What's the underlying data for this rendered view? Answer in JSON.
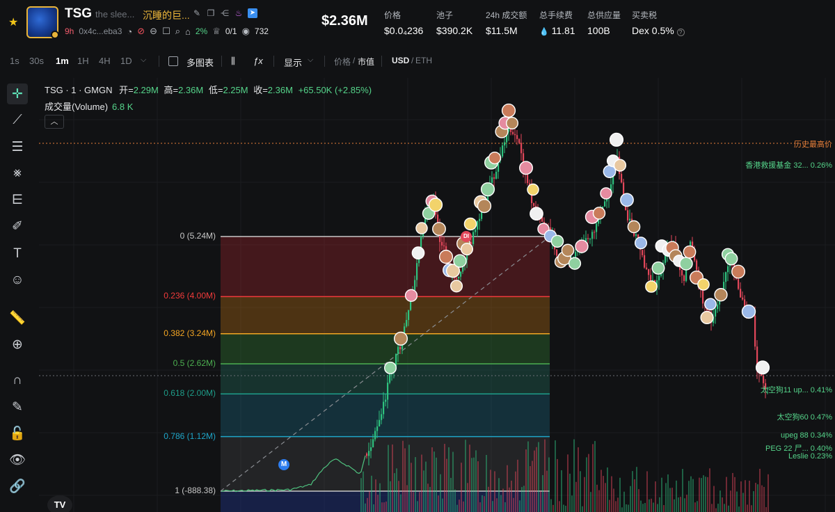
{
  "header": {
    "symbol": "TSG",
    "subtitle": "the slee...",
    "chinese_name": "沉睡的巨...",
    "age": "9h",
    "address": "0x4c...eba3",
    "pct": "2%",
    "holders_ratio": "0/1",
    "views": "732",
    "big_price": "$2.36M",
    "stats": [
      {
        "label": "价格",
        "value": "$0.0₄236"
      },
      {
        "label": "池子",
        "value": "$390.2K"
      },
      {
        "label": "24h 成交额",
        "value": "$11.5M"
      },
      {
        "label": "总手续费",
        "value": "11.81"
      },
      {
        "label": "总供应量",
        "value": "100B"
      },
      {
        "label": "买卖税",
        "value": "Dex 0.5%"
      }
    ],
    "colors": {
      "accent_gold": "#f0b93a",
      "age_red": "#f25c6c",
      "green": "#55d48a"
    },
    "icons": [
      "star-icon",
      "edit-icon",
      "copy-icon",
      "share-icon",
      "flame-icon",
      "telegram-icon",
      "clock-icon",
      "pill-icon",
      "minus-circle-icon",
      "chat-icon",
      "search-icon",
      "cap-icon",
      "crown-icon",
      "eye-icon"
    ]
  },
  "toolbar": {
    "timeframes": [
      "1s",
      "30s",
      "1m",
      "1H",
      "4H",
      "1D"
    ],
    "active_timeframe": "1m",
    "multi_chart": "多图表",
    "display": "显示",
    "price_label": "价格",
    "slash1": "/",
    "mcap_label": "市值",
    "usd": "USD",
    "slash2": "/",
    "eth": "ETH"
  },
  "chart": {
    "legend": {
      "title": "TSG · 1 · GMGN",
      "open_label": "开=",
      "open": "2.29M",
      "high_label": "高=",
      "high": "2.36M",
      "low_label": "低=",
      "low": "2.25M",
      "close_label": "收=",
      "close": "2.36M",
      "change": "+65.50K (+2.85%)"
    },
    "volume_label": "成交量(Volume)",
    "volume_value": "6.8 K",
    "ath_label": "历史最高价",
    "m_badge": "M",
    "d_badge": "DI",
    "right_labels": [
      {
        "text": "香港救援基金 32... 0.26%"
      },
      {
        "text": "太空狗11 up... 0.41%"
      },
      {
        "text": "太空狗60 0.47%"
      },
      {
        "text": "upeg 88 0.34%"
      },
      {
        "text": "PEG 22 尸... 0.40%"
      },
      {
        "text": "Leslie 0.23%"
      }
    ],
    "fib_levels": [
      {
        "label": "0 (5.24M)",
        "ratio": 0,
        "color": "#c8c8c8"
      },
      {
        "label": "0.236 (4.00M)",
        "ratio": 0.236,
        "color": "#f23b3b"
      },
      {
        "label": "0.382 (3.24M)",
        "ratio": 0.382,
        "color": "#f5a623"
      },
      {
        "label": "0.5 (2.62M)",
        "ratio": 0.5,
        "color": "#4caf50"
      },
      {
        "label": "0.618 (2.00M)",
        "ratio": 0.618,
        "color": "#1e9e8a"
      },
      {
        "label": "0.786 (1.12M)",
        "ratio": 0.786,
        "color": "#1ea6c9"
      },
      {
        "label": "1 (-888.38)",
        "ratio": 1,
        "color": "#c8c8c8"
      }
    ]
  }
}
